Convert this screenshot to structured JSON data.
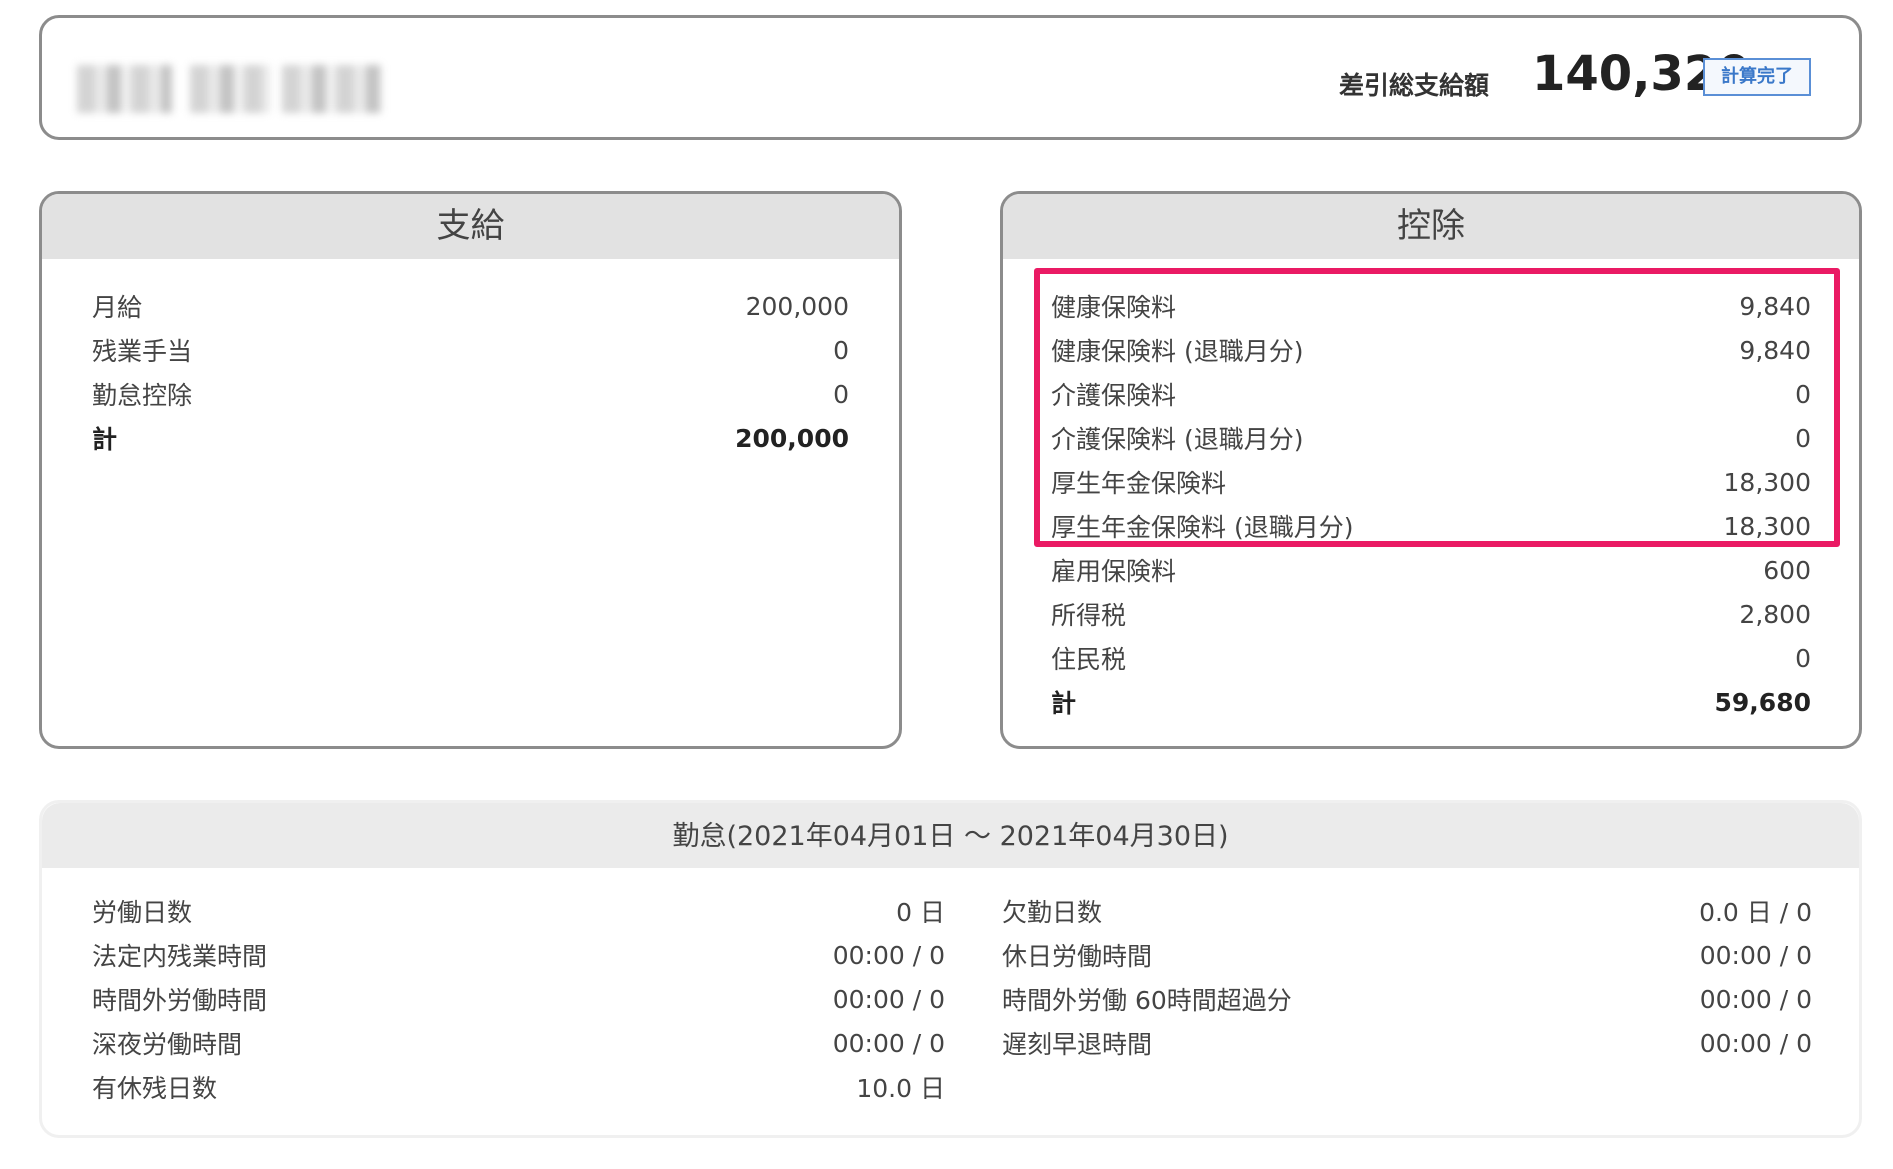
{
  "header": {
    "net_label": "差引総支給額",
    "net_amount": "140,320",
    "status_badge": "計算完了"
  },
  "payments": {
    "title": "支給",
    "rows": [
      {
        "label": "月給",
        "value": "200,000"
      },
      {
        "label": "残業手当",
        "value": "0"
      },
      {
        "label": "勤怠控除",
        "value": "0"
      }
    ],
    "total_label": "計",
    "total_value": "200,000"
  },
  "deductions": {
    "title": "控除",
    "rows": [
      {
        "label": "健康保険料",
        "value": "9,840"
      },
      {
        "label": "健康保険料 (退職月分)",
        "value": "9,840"
      },
      {
        "label": "介護保険料",
        "value": "0"
      },
      {
        "label": "介護保険料 (退職月分)",
        "value": "0"
      },
      {
        "label": "厚生年金保険料",
        "value": "18,300"
      },
      {
        "label": "厚生年金保険料 (退職月分)",
        "value": "18,300"
      },
      {
        "label": "雇用保険料",
        "value": "600"
      },
      {
        "label": "所得税",
        "value": "2,800"
      },
      {
        "label": "住民税",
        "value": "0"
      }
    ],
    "total_label": "計",
    "total_value": "59,680",
    "highlight_color": "#ea1a64"
  },
  "attendance": {
    "title": "勤怠(2021年04月01日 〜 2021年04月30日)",
    "left": [
      {
        "label": "労働日数",
        "value": "0 日"
      },
      {
        "label": "法定内残業時間",
        "value": "00:00 / 0"
      },
      {
        "label": "時間外労働時間",
        "value": "00:00 / 0"
      },
      {
        "label": "深夜労働時間",
        "value": "00:00 / 0"
      },
      {
        "label": "有休残日数",
        "value": "10.0 日"
      }
    ],
    "right": [
      {
        "label": "欠勤日数",
        "value": "0.0 日 / 0"
      },
      {
        "label": "休日労働時間",
        "value": "00:00 / 0"
      },
      {
        "label": "時間外労働 60時間超過分",
        "value": "00:00 / 0"
      },
      {
        "label": "遅刻早退時間",
        "value": "00:00 / 0"
      }
    ]
  }
}
